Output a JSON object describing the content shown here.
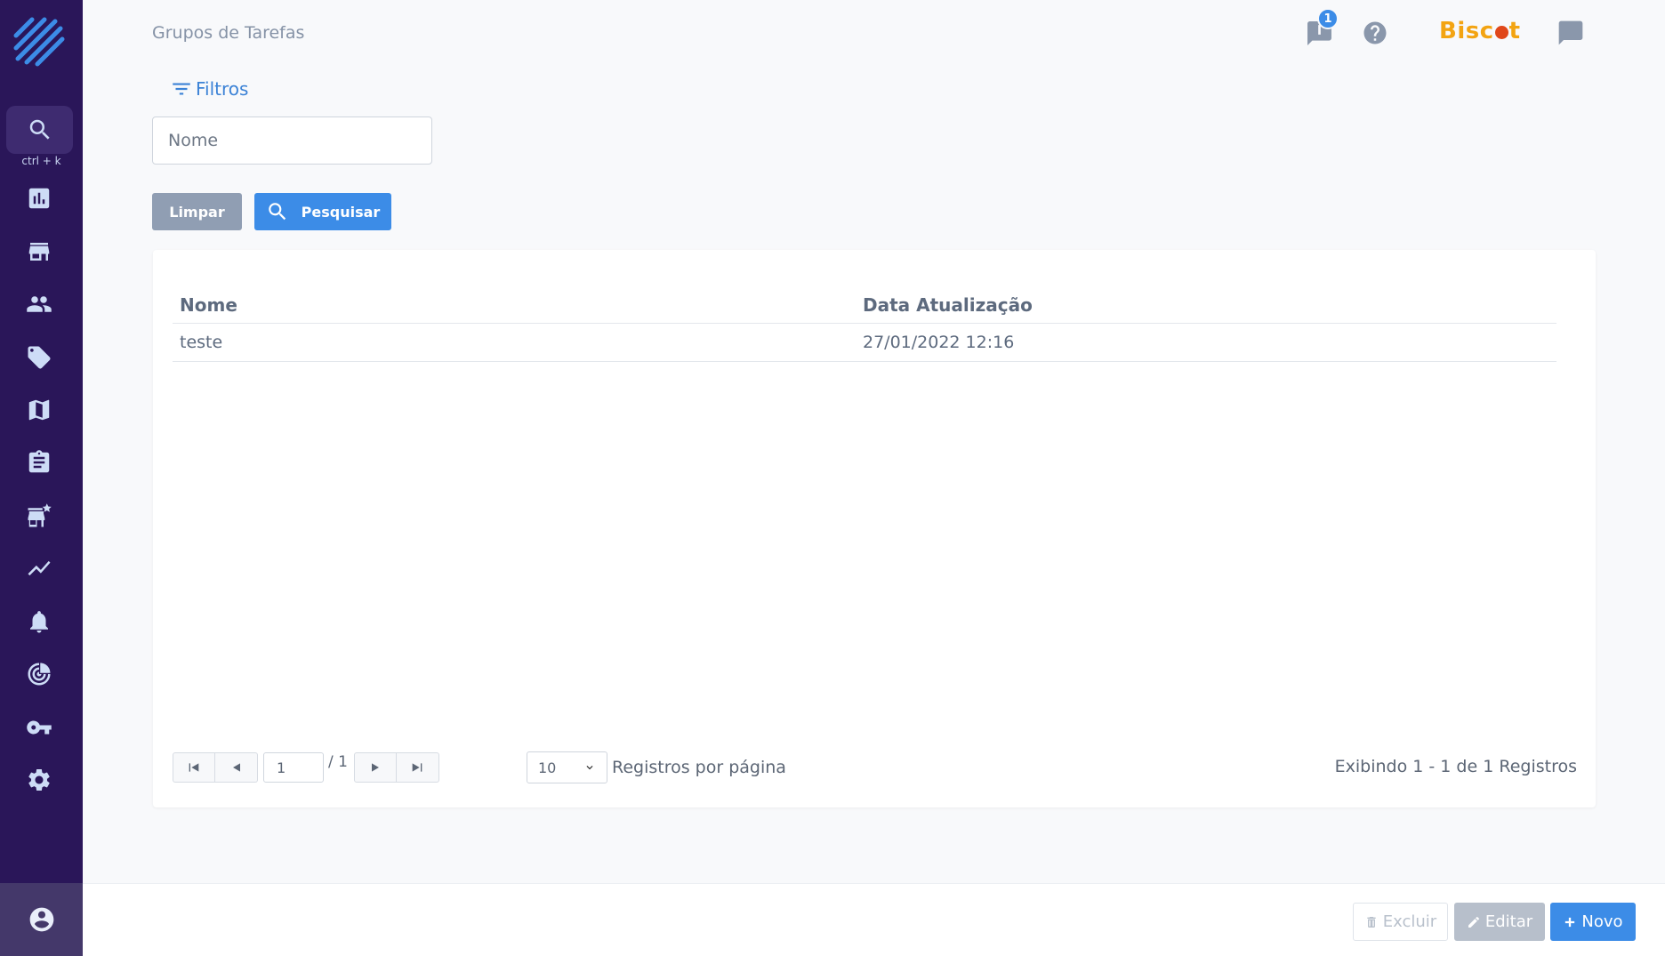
{
  "sidebar": {
    "search_hint": "ctrl + k",
    "items": [
      {
        "icon": "chart-icon",
        "label": "Dashboard"
      },
      {
        "icon": "store-icon",
        "label": "Lojas"
      },
      {
        "icon": "people-icon",
        "label": "Usuários"
      },
      {
        "icon": "tag-icon",
        "label": "Produtos"
      },
      {
        "icon": "map-icon",
        "label": "Mapa"
      },
      {
        "icon": "clipboard-icon",
        "label": "Tarefas"
      },
      {
        "icon": "store-star-icon",
        "label": "Avaliações"
      },
      {
        "icon": "trend-icon",
        "label": "Relatórios"
      },
      {
        "icon": "bell-icon",
        "label": "Notificações"
      },
      {
        "icon": "target-icon",
        "label": "Metas"
      },
      {
        "icon": "key-icon",
        "label": "Acessos"
      },
      {
        "icon": "gear-icon",
        "label": "Configurações"
      }
    ]
  },
  "header": {
    "title": "Grupos de Tarefas",
    "notification_count": "1",
    "brand_prefix": "Bisc",
    "brand_suffix": "t"
  },
  "filters": {
    "toggle_label": "Filtros",
    "name_placeholder": "Nome",
    "clear_label": "Limpar",
    "search_label": "Pesquisar"
  },
  "table": {
    "columns": [
      "Nome",
      "Data Atualização"
    ],
    "rows": [
      {
        "nome": "teste",
        "data": "27/01/2022 12:16"
      }
    ]
  },
  "pagination": {
    "current_page": "1",
    "total_pages": "/ 1",
    "per_page": "10",
    "per_page_label": "Registros por página",
    "summary": "Exibindo 1 - 1 de 1 Registros"
  },
  "footer": {
    "delete_label": "Excluir",
    "edit_label": "Editar",
    "new_label": "Novo"
  },
  "colors": {
    "sidebar_bg": "#2a1659",
    "accent": "#3c8ce7",
    "brand": "#f3a412"
  }
}
